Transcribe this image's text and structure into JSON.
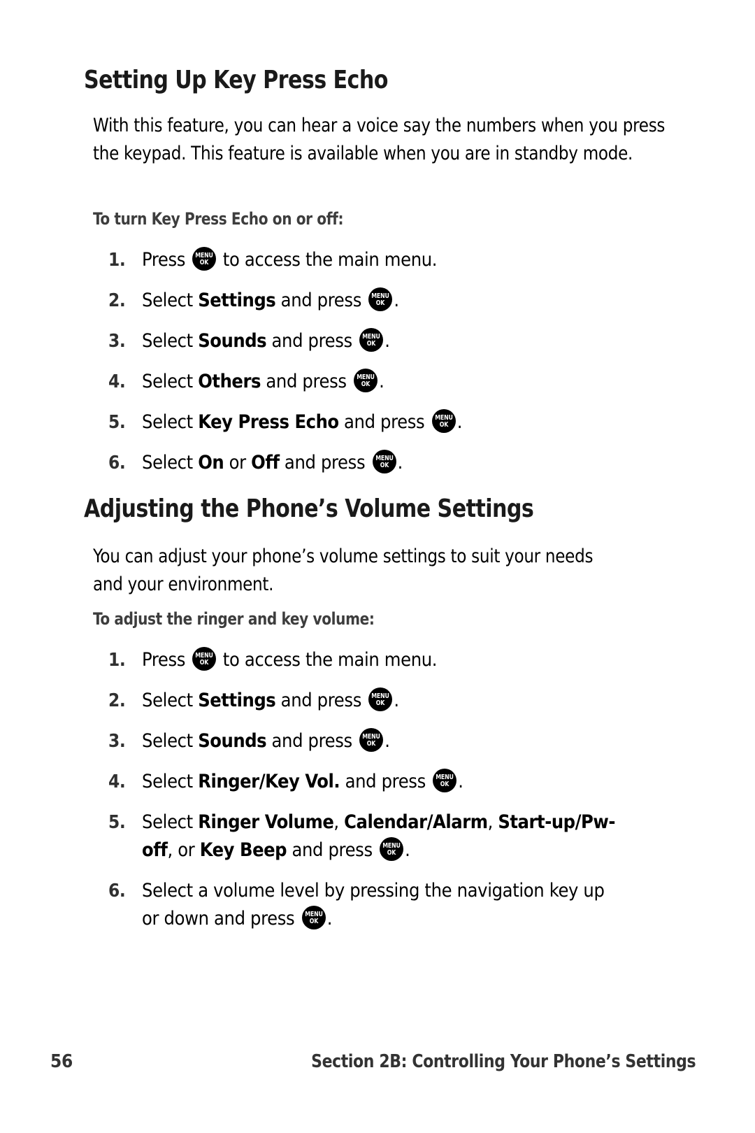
{
  "page": {
    "number": "56",
    "footer_title": "Section 2B: Controlling Your Phone’s Settings"
  },
  "icons": {
    "menu_ok": {
      "top": "MENU",
      "bottom": "OK",
      "name": "menu-ok-key-icon"
    }
  },
  "sections": [
    {
      "heading": "Setting Up Key Press Echo",
      "intro": "With this feature, you can hear a voice say the numbers when you press the keypad. This feature is available when you are in standby mode.",
      "subhead": "To turn Key Press Echo on or off:",
      "steps": [
        {
          "num": "1.",
          "parts": [
            {
              "t": "text",
              "v": "Press "
            },
            {
              "t": "icon",
              "v": "menu_ok"
            },
            {
              "t": "text",
              "v": " to access the main menu."
            }
          ]
        },
        {
          "num": "2.",
          "parts": [
            {
              "t": "text",
              "v": "Select "
            },
            {
              "t": "bold",
              "v": "Settings"
            },
            {
              "t": "text",
              "v": " and press "
            },
            {
              "t": "icon",
              "v": "menu_ok"
            },
            {
              "t": "text",
              "v": "."
            }
          ]
        },
        {
          "num": "3.",
          "parts": [
            {
              "t": "text",
              "v": "Select "
            },
            {
              "t": "bold",
              "v": "Sounds"
            },
            {
              "t": "text",
              "v": " and press "
            },
            {
              "t": "icon",
              "v": "menu_ok"
            },
            {
              "t": "text",
              "v": "."
            }
          ]
        },
        {
          "num": "4.",
          "parts": [
            {
              "t": "text",
              "v": "Select "
            },
            {
              "t": "bold",
              "v": "Others"
            },
            {
              "t": "text",
              "v": " and press "
            },
            {
              "t": "icon",
              "v": "menu_ok"
            },
            {
              "t": "text",
              "v": "."
            }
          ]
        },
        {
          "num": "5.",
          "parts": [
            {
              "t": "text",
              "v": "Select "
            },
            {
              "t": "bold",
              "v": "Key Press Echo"
            },
            {
              "t": "text",
              "v": " and press "
            },
            {
              "t": "icon",
              "v": "menu_ok"
            },
            {
              "t": "text",
              "v": "."
            }
          ]
        },
        {
          "num": "6.",
          "parts": [
            {
              "t": "text",
              "v": "Select "
            },
            {
              "t": "bold",
              "v": "On"
            },
            {
              "t": "text",
              "v": " or "
            },
            {
              "t": "bold",
              "v": "Off"
            },
            {
              "t": "text",
              "v": " and press "
            },
            {
              "t": "icon",
              "v": "menu_ok"
            },
            {
              "t": "text",
              "v": "."
            }
          ]
        }
      ]
    },
    {
      "heading": "Adjusting the Phone’s Volume Settings",
      "intro": "You can adjust your phone’s volume settings to suit your needs and your environment.",
      "subhead": "To adjust the ringer and key volume:",
      "steps": [
        {
          "num": "1.",
          "parts": [
            {
              "t": "text",
              "v": "Press "
            },
            {
              "t": "icon",
              "v": "menu_ok"
            },
            {
              "t": "text",
              "v": " to access the main menu."
            }
          ]
        },
        {
          "num": "2.",
          "parts": [
            {
              "t": "text",
              "v": "Select "
            },
            {
              "t": "bold",
              "v": "Settings"
            },
            {
              "t": "text",
              "v": " and press "
            },
            {
              "t": "icon",
              "v": "menu_ok"
            },
            {
              "t": "text",
              "v": "."
            }
          ]
        },
        {
          "num": "3.",
          "parts": [
            {
              "t": "text",
              "v": "Select "
            },
            {
              "t": "bold",
              "v": "Sounds"
            },
            {
              "t": "text",
              "v": " and press "
            },
            {
              "t": "icon",
              "v": "menu_ok"
            },
            {
              "t": "text",
              "v": "."
            }
          ]
        },
        {
          "num": "4.",
          "parts": [
            {
              "t": "text",
              "v": "Select "
            },
            {
              "t": "bold",
              "v": "Ringer/Key Vol."
            },
            {
              "t": "text",
              "v": " and press "
            },
            {
              "t": "icon",
              "v": "menu_ok"
            },
            {
              "t": "text",
              "v": "."
            }
          ]
        },
        {
          "num": "5.",
          "parts": [
            {
              "t": "text",
              "v": "Select "
            },
            {
              "t": "bold",
              "v": "Ringer Volume"
            },
            {
              "t": "text",
              "v": ", "
            },
            {
              "t": "bold",
              "v": "Calendar/Alarm"
            },
            {
              "t": "text",
              "v": ", "
            },
            {
              "t": "bold",
              "v": "Start-up/Pw-off"
            },
            {
              "t": "text",
              "v": ", or "
            },
            {
              "t": "bold",
              "v": "Key Beep"
            },
            {
              "t": "text",
              "v": " and press "
            },
            {
              "t": "icon",
              "v": "menu_ok"
            },
            {
              "t": "text",
              "v": "."
            }
          ]
        },
        {
          "num": "6.",
          "parts": [
            {
              "t": "text",
              "v": "Select a volume level by pressing the navigation key up or down and press "
            },
            {
              "t": "icon",
              "v": "menu_ok"
            },
            {
              "t": "text",
              "v": "."
            }
          ]
        }
      ]
    }
  ]
}
